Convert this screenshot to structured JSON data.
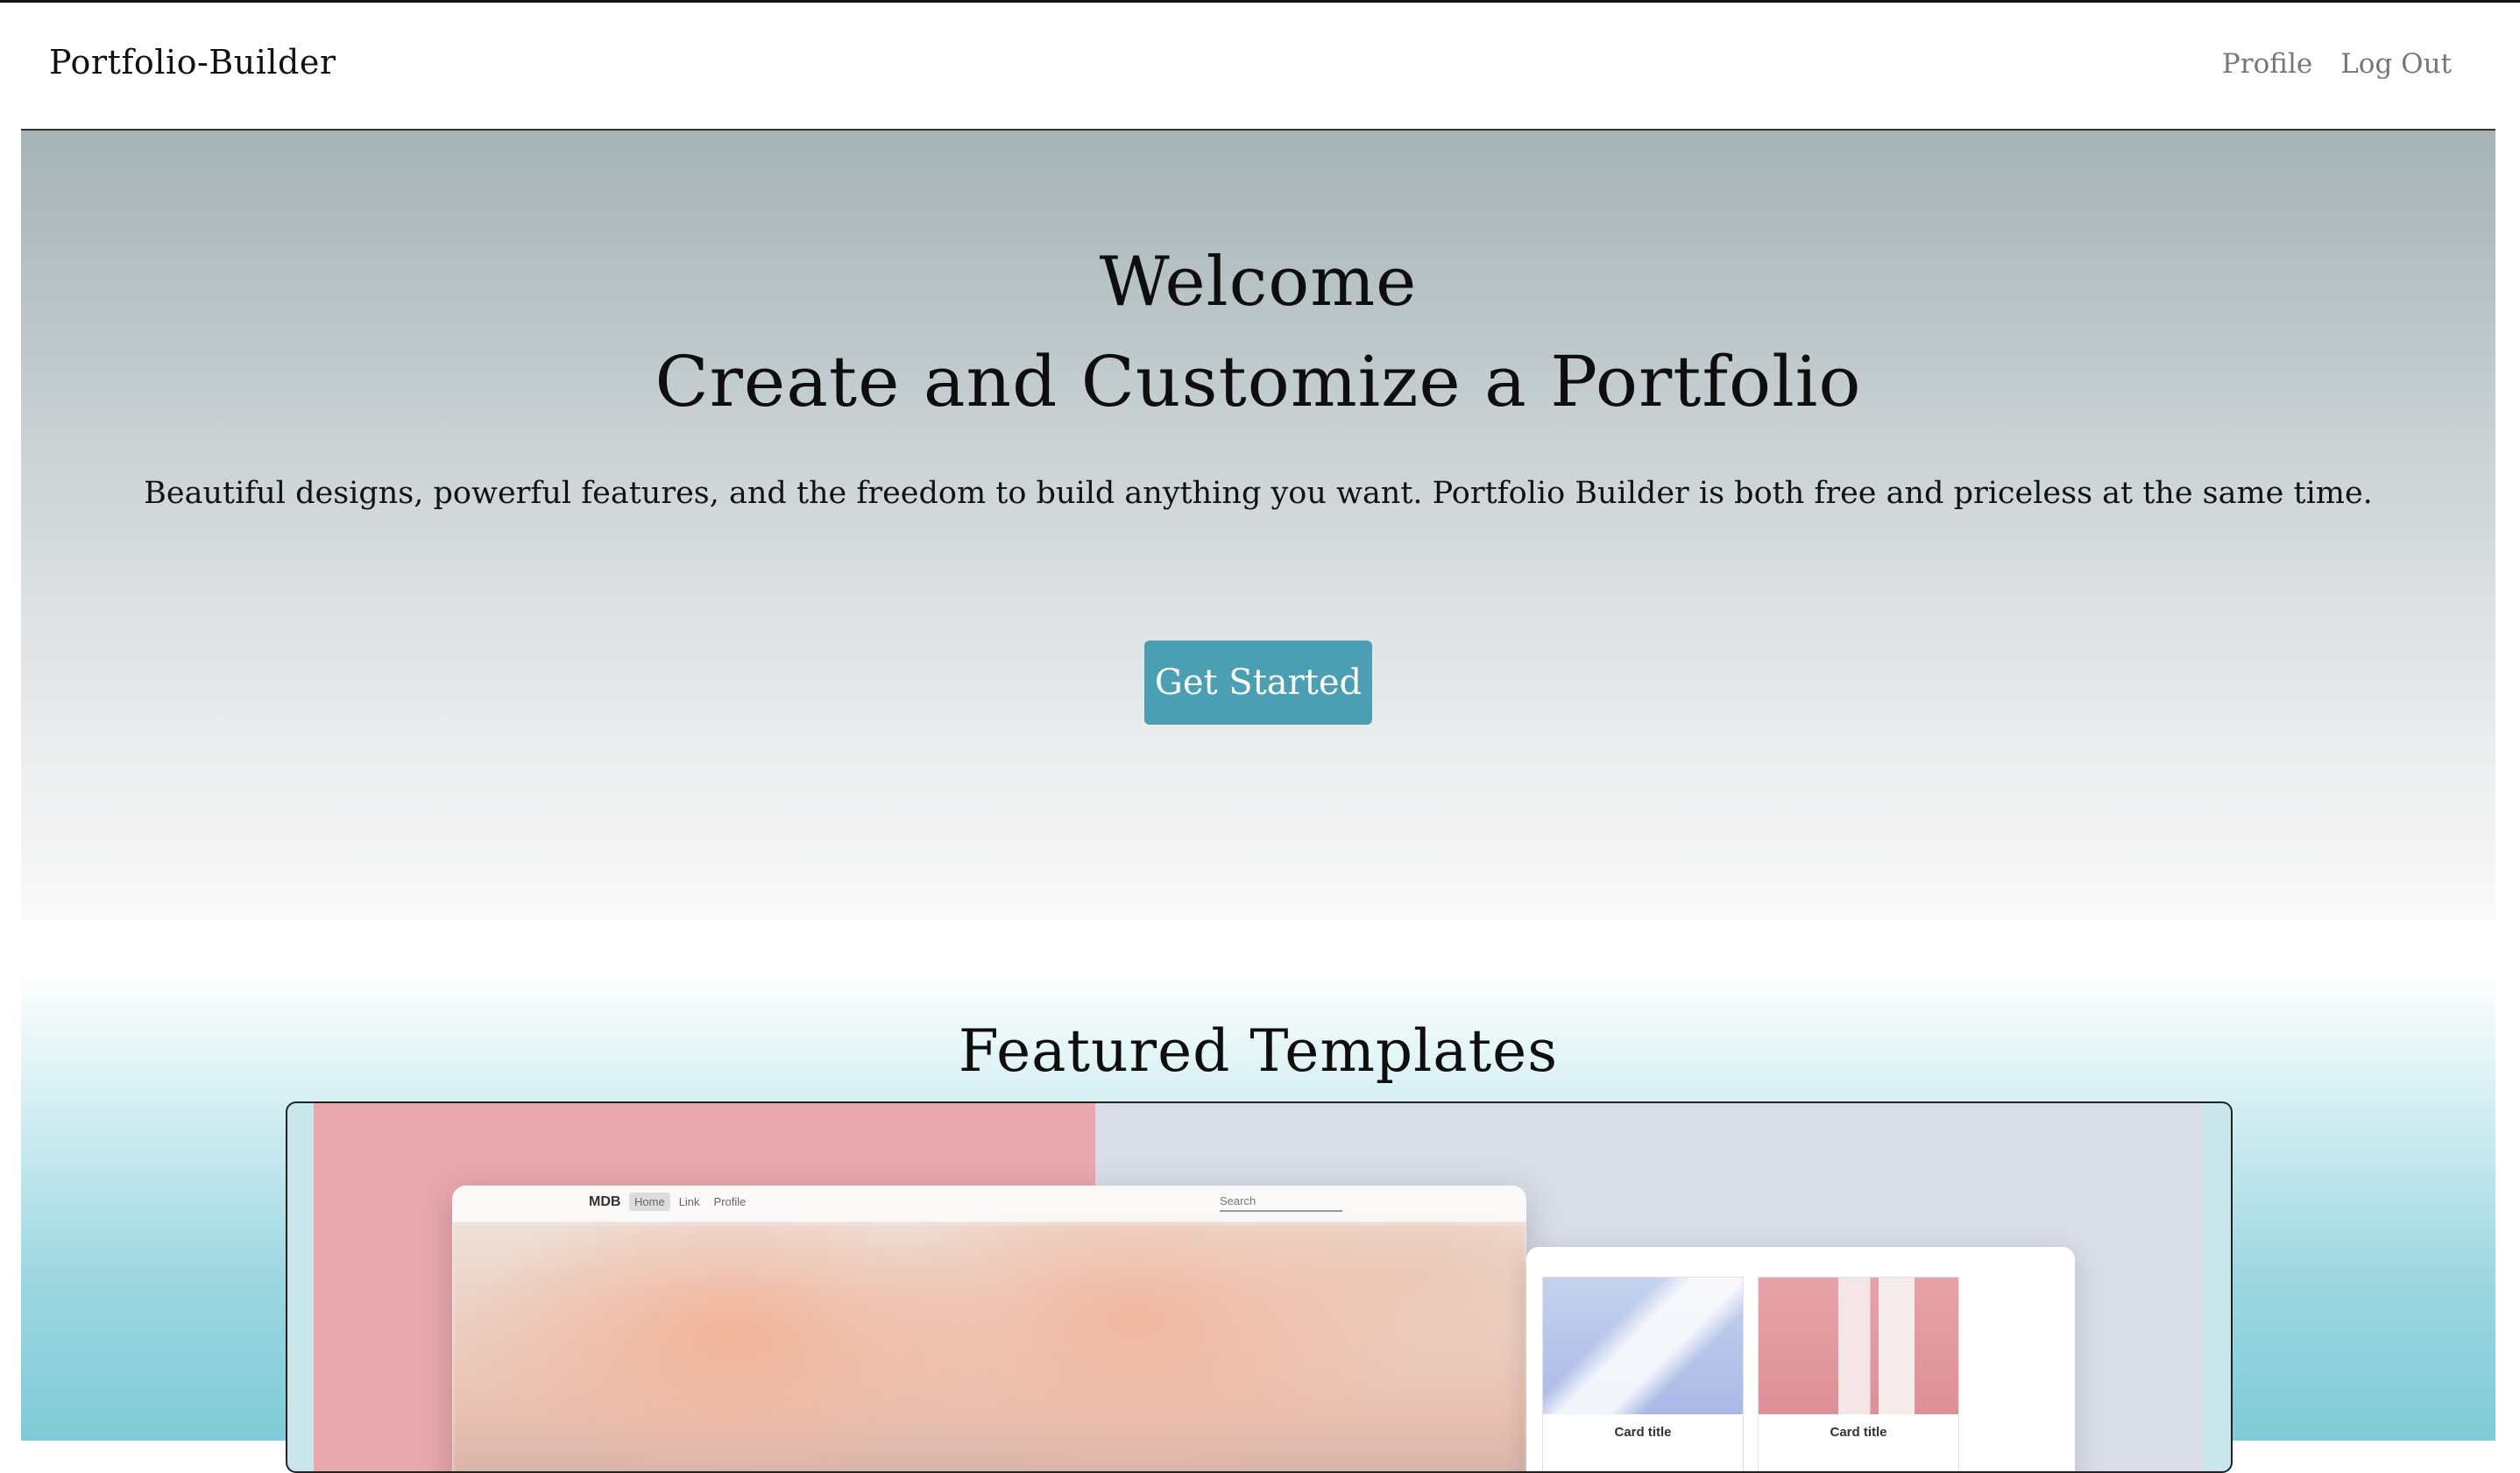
{
  "navbar": {
    "brand": "Portfolio-Builder",
    "links": [
      "Profile",
      "Log Out"
    ]
  },
  "hero": {
    "welcome": "Welcome",
    "title": "Create and Customize a Portfolio",
    "description": "Beautiful designs, powerful features, and the freedom to build anything you want. Portfolio Builder is both free and priceless at the same time.",
    "cta_label": "Get Started"
  },
  "featured": {
    "title": "Featured Templates",
    "preview": {
      "logo": "MDB",
      "nav": [
        "Home",
        "Link",
        "Profile"
      ],
      "search_placeholder": "Search",
      "cards": [
        "Card title",
        "Card title"
      ]
    }
  },
  "colors": {
    "accent": "#4a9fb2",
    "hero_top": "#a5b3b7",
    "featured_bottom": "#7fcbd8"
  }
}
